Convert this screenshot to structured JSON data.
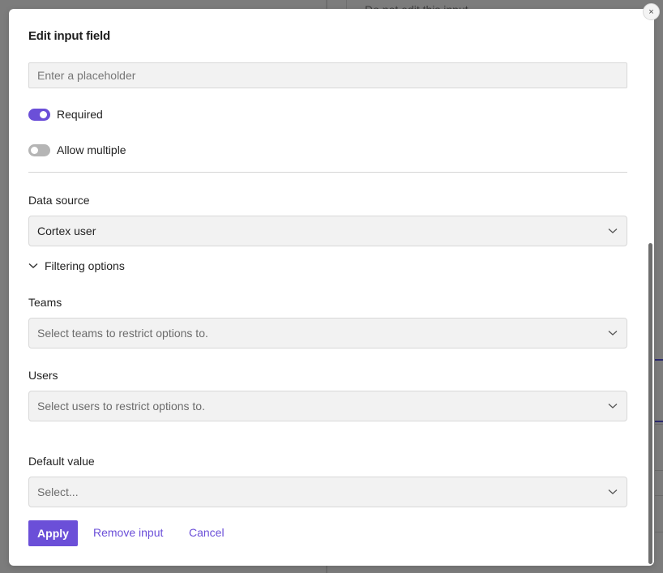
{
  "background": {
    "partial_text": "Do not edit this input"
  },
  "modal": {
    "title": "Edit input field",
    "close_icon": "×",
    "placeholder_input": {
      "value": "",
      "placeholder": "Enter a placeholder"
    },
    "toggles": [
      {
        "label": "Required",
        "on": true
      },
      {
        "label": "Allow multiple",
        "on": false
      }
    ],
    "data_source": {
      "label": "Data source",
      "value": "Cortex user"
    },
    "filtering": {
      "label": "Filtering options",
      "expanded": true,
      "teams": {
        "label": "Teams",
        "placeholder": "Select teams to restrict options to."
      },
      "users": {
        "label": "Users",
        "placeholder": "Select users to restrict options to."
      }
    },
    "default_value": {
      "label": "Default value",
      "placeholder": "Select..."
    },
    "actions": {
      "apply": "Apply",
      "remove": "Remove input",
      "cancel": "Cancel"
    }
  },
  "colors": {
    "accent": "#6b4fd8",
    "toggle_off": "#b5b5b5",
    "input_bg": "#f2f2f2",
    "backdrop": "#7c7c7c"
  }
}
